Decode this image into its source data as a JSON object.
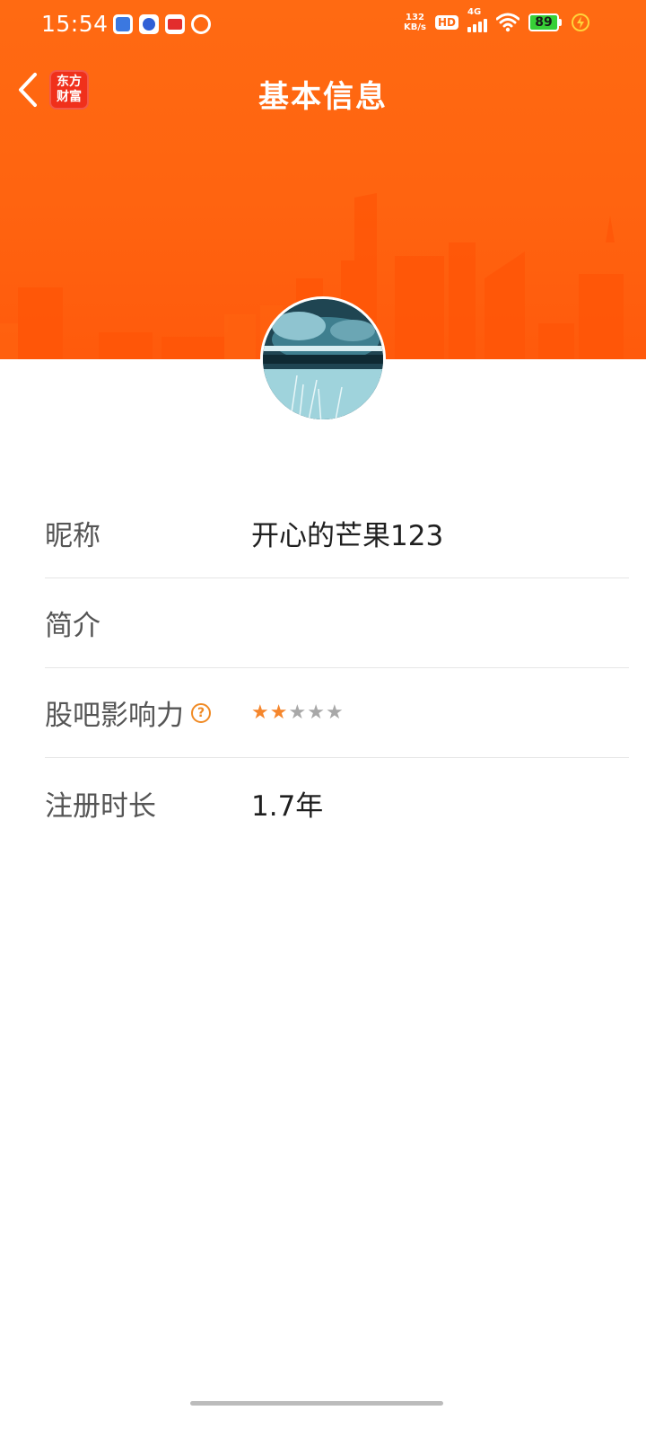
{
  "status_bar": {
    "time": "15:54",
    "net_speed_value": "132",
    "net_speed_unit": "KB/s",
    "hd_label": "HD",
    "signal_label": "4G",
    "battery_level": "89"
  },
  "nav": {
    "title": "基本信息",
    "logo_line1": "东方",
    "logo_line2": "财富"
  },
  "profile": {
    "rows": [
      {
        "label": "昵称",
        "value": "开心的芒果123"
      },
      {
        "label": "简介",
        "value": ""
      },
      {
        "label": "股吧影响力",
        "help": "?",
        "rating": 2,
        "rating_max": 5
      },
      {
        "label": "注册时长",
        "value": "1.7年"
      }
    ]
  },
  "colors": {
    "header_orange": "#ff6a12",
    "star_active": "#f5862c",
    "star_inactive": "#a8a8a8",
    "help_icon": "#f08a24"
  },
  "icons": {
    "back": "chevron-left-icon",
    "help": "question-circle-icon",
    "star": "star-icon"
  }
}
